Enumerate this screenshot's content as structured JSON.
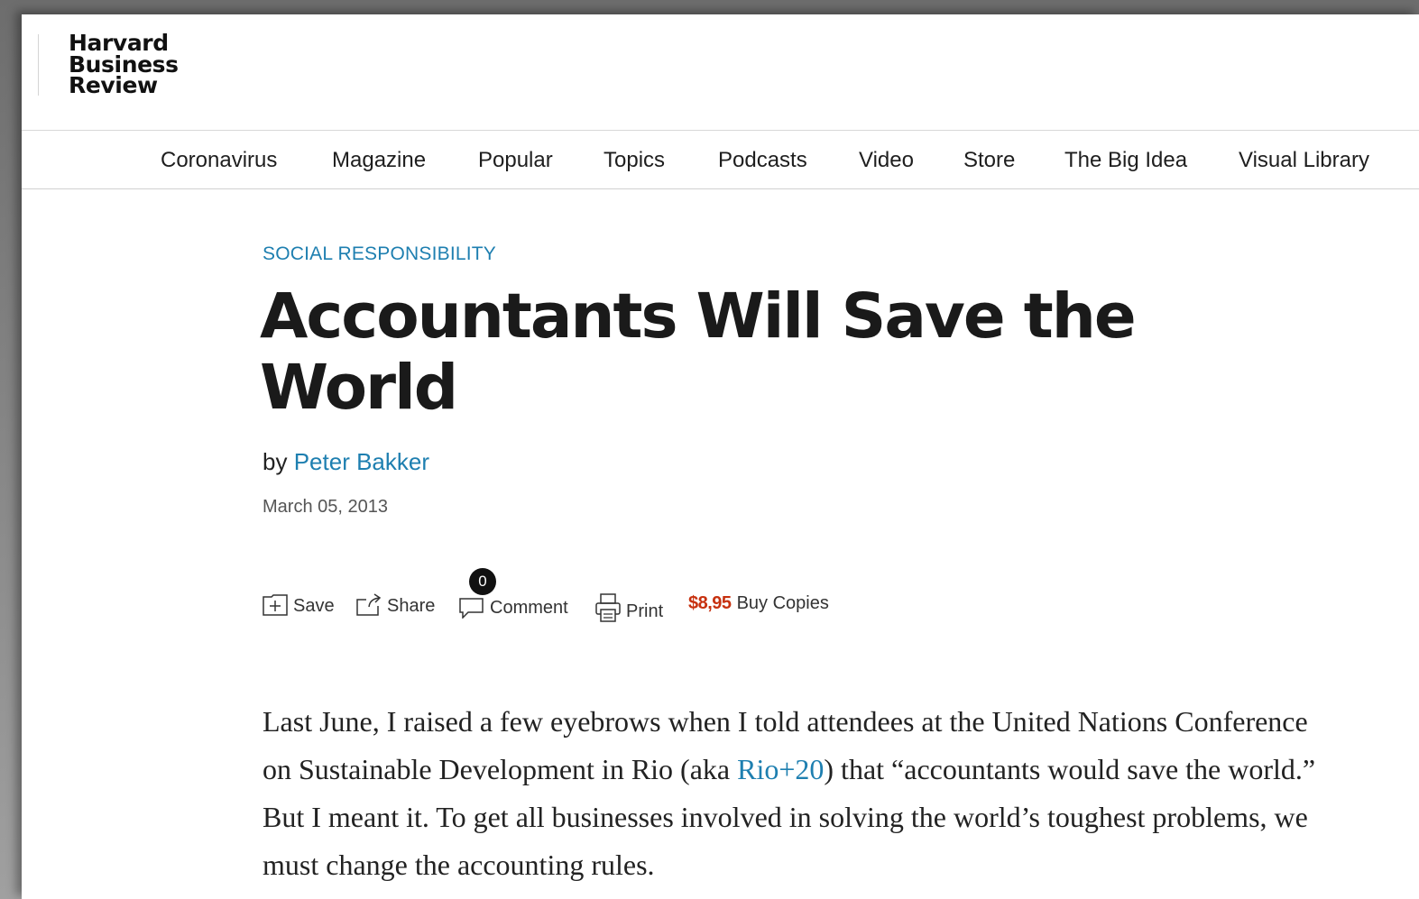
{
  "brand": {
    "logo_lines": [
      "Harvard",
      "Business",
      "Review"
    ]
  },
  "nav": {
    "items": [
      "Coronavirus",
      "Magazine",
      "Popular",
      "Topics",
      "Podcasts",
      "Video",
      "Store",
      "The Big Idea",
      "Visual Library"
    ]
  },
  "article": {
    "topic": "SOCIAL RESPONSIBILITY",
    "title": "Accountants Will Save the World",
    "byline_prefix": "by",
    "author": "Peter Bakker",
    "date": "March 05, 2013"
  },
  "toolbar": {
    "save_label": "Save",
    "share_label": "Share",
    "comment_label": "Comment",
    "comment_count": "0",
    "print_label": "Print",
    "price": "$8,95",
    "buy_label": "Buy Copies"
  },
  "body": {
    "p1_before_link": "Last June, I raised a few eyebrows when I told attendees at the United Nations Conference on Sustainable Development in Rio (aka ",
    "p1_link": "Rio+20",
    "p1_after_link": ") that “accountants would save the world.” But I meant it. To get all businesses involved in solving the world’s toughest problems, we must change the accounting rules."
  },
  "colors": {
    "link_blue": "#1e7fb0",
    "price_red": "#c7310f",
    "text": "#1a1a1a"
  }
}
